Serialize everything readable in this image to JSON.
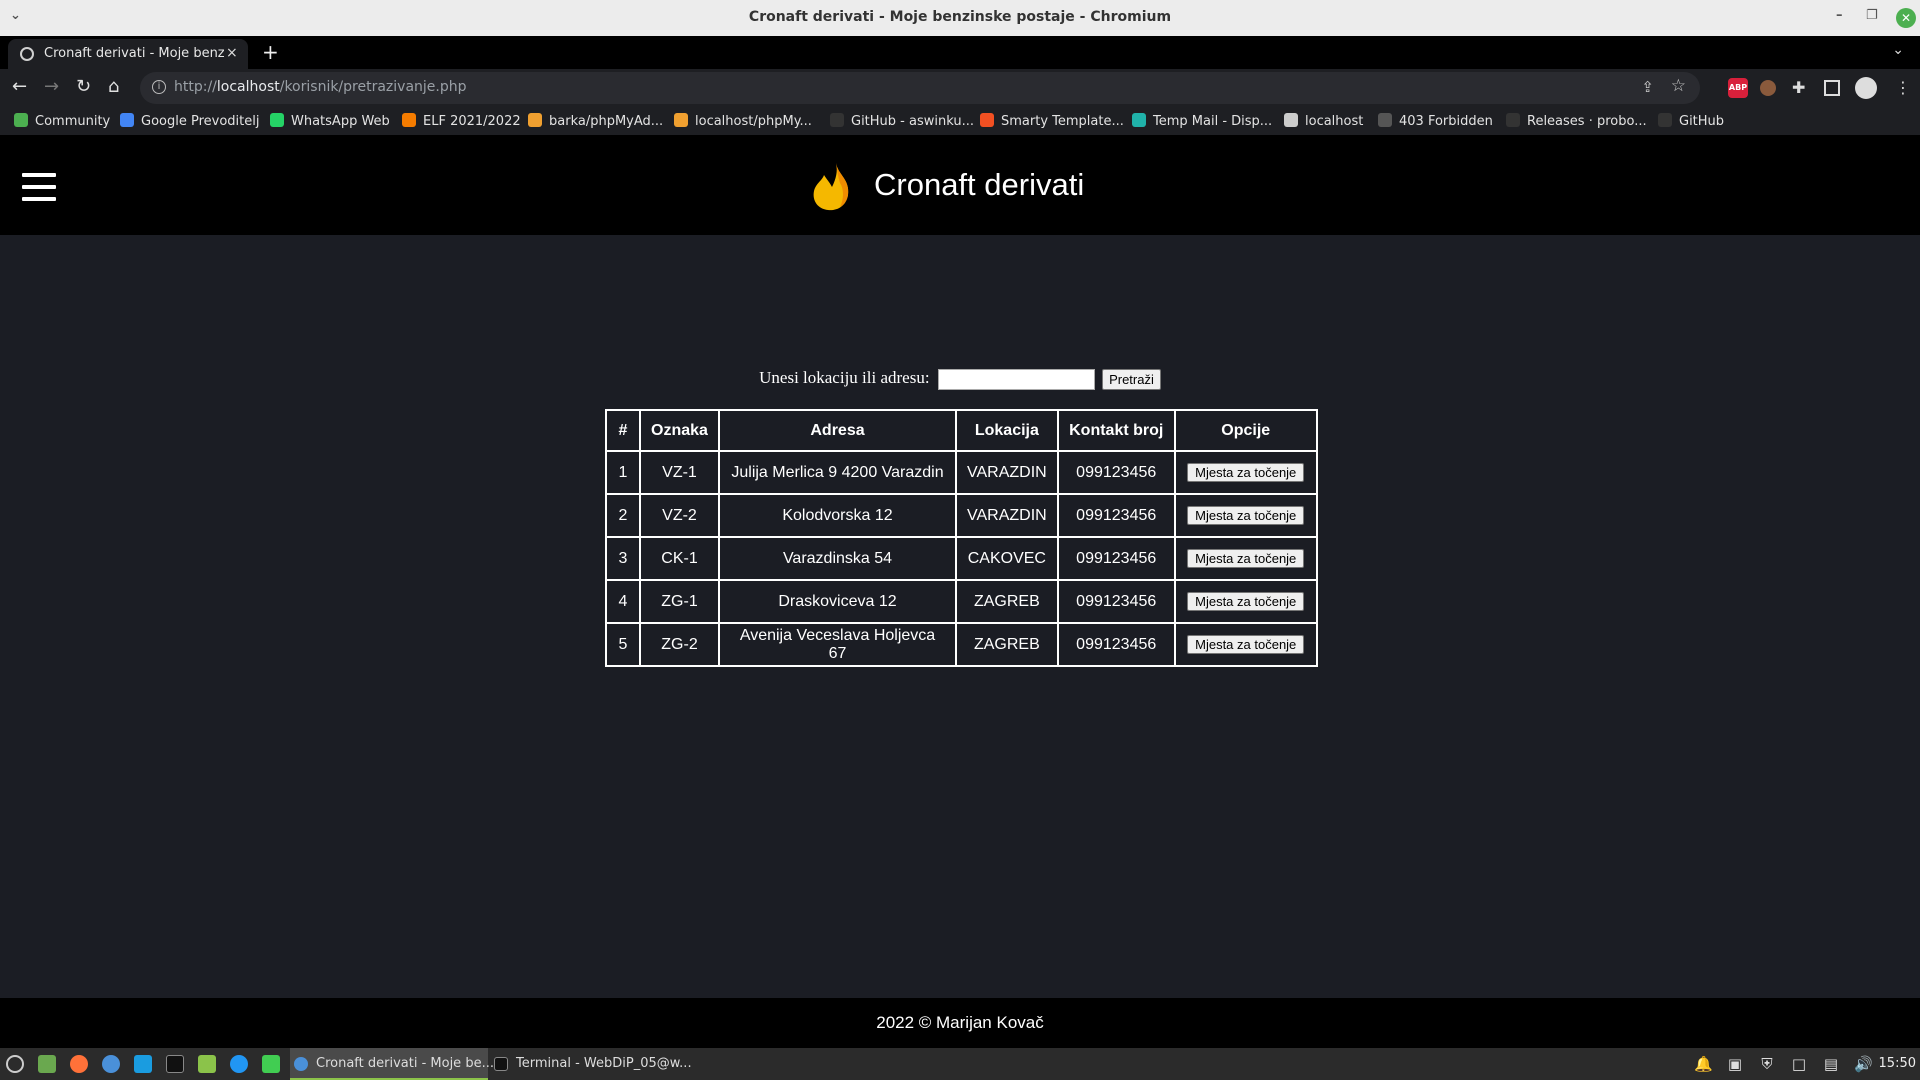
{
  "window": {
    "title": "Cronaft derivati - Moje benzinske postaje - Chromium"
  },
  "tab": {
    "label": "Cronaft derivati - Moje benzin",
    "close": "×",
    "new_tab": "+"
  },
  "address_bar": {
    "url_scheme": "http://",
    "url_host": "localhost",
    "url_path": "/korisnik/pretrazivanje.php"
  },
  "bookmarks": [
    {
      "label": "Community",
      "icon": "community-icon",
      "color": "#4caf50"
    },
    {
      "label": "Google Prevoditelj",
      "icon": "translate-icon",
      "color": "#4285f4"
    },
    {
      "label": "WhatsApp Web",
      "icon": "whatsapp-icon",
      "color": "#25d366"
    },
    {
      "label": "ELF 2021/2022",
      "icon": "elf-icon",
      "color": "#f57c00"
    },
    {
      "label": "barka/phpMyAd...",
      "icon": "phpmyadmin-icon",
      "color": "#f0a030"
    },
    {
      "label": "localhost/phpMy...",
      "icon": "phpmyadmin-icon",
      "color": "#f0a030"
    },
    {
      "label": "GitHub - aswinku...",
      "icon": "github-icon",
      "color": "#333333"
    },
    {
      "label": "Smarty Template...",
      "icon": "microsoft-icon",
      "color": "#f25022"
    },
    {
      "label": "Temp Mail - Disp...",
      "icon": "tempmail-icon",
      "color": "#20b2aa"
    },
    {
      "label": "localhost",
      "icon": "globe-icon",
      "color": "#cccccc"
    },
    {
      "label": "403 Forbidden",
      "icon": "forbidden-icon",
      "color": "#555555"
    },
    {
      "label": "Releases · probo...",
      "icon": "github-icon",
      "color": "#333333"
    },
    {
      "label": "GitHub",
      "icon": "github-icon",
      "color": "#333333"
    }
  ],
  "site": {
    "title": "Cronaft derivati",
    "logo": "flame-icon",
    "accent": "#f5b800"
  },
  "search": {
    "label": "Unesi lokaciju ili adresu:",
    "value": "",
    "button": "Pretraži"
  },
  "table": {
    "headers": [
      "#",
      "Oznaka",
      "Adresa",
      "Lokacija",
      "Kontakt broj",
      "Opcije"
    ],
    "rows": [
      {
        "id": "1",
        "oznaka": "VZ-1",
        "adresa": "Julija Merlica 9 4200 Varazdin",
        "lokacija": "VARAZDIN",
        "kontakt": "099123456",
        "opcija": "Mjesta za točenje"
      },
      {
        "id": "2",
        "oznaka": "VZ-2",
        "adresa": "Kolodvorska 12",
        "lokacija": "VARAZDIN",
        "kontakt": "099123456",
        "opcija": "Mjesta za točenje"
      },
      {
        "id": "3",
        "oznaka": "CK-1",
        "adresa": "Varazdinska 54",
        "lokacija": "CAKOVEC",
        "kontakt": "099123456",
        "opcija": "Mjesta za točenje"
      },
      {
        "id": "4",
        "oznaka": "ZG-1",
        "adresa": "Draskoviceva 12",
        "lokacija": "ZAGREB",
        "kontakt": "099123456",
        "opcija": "Mjesta za točenje"
      },
      {
        "id": "5",
        "oznaka": "ZG-2",
        "adresa": "Avenija Veceslava Holjevca 67",
        "lokacija": "ZAGREB",
        "kontakt": "099123456",
        "opcija": "Mjesta za točenje"
      }
    ]
  },
  "footer": {
    "text": "2022 © Marijan Kovač"
  },
  "taskbar": {
    "tasks": [
      {
        "label": "Cronaft derivati - Moje be...",
        "active": true
      },
      {
        "label": "Terminal - WebDiP_05@w...",
        "active": false
      }
    ],
    "clock": "15:50"
  }
}
